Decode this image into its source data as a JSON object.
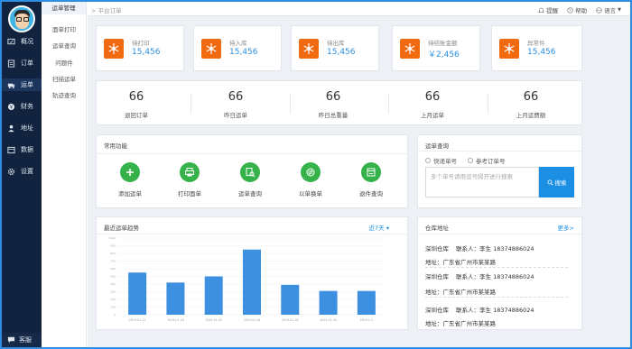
{
  "nav": {
    "items": [
      {
        "label": "概况",
        "icon": "overview-icon"
      },
      {
        "label": "订单",
        "icon": "order-icon"
      },
      {
        "label": "运单",
        "icon": "waybill-icon"
      },
      {
        "label": "财务",
        "icon": "finance-icon"
      },
      {
        "label": "地址",
        "icon": "address-icon"
      },
      {
        "label": "数据",
        "icon": "data-icon"
      },
      {
        "label": "设置",
        "icon": "settings-icon"
      }
    ],
    "support": "客服"
  },
  "submenu": {
    "header": "运单管理",
    "items": [
      "面单打印",
      "运单查询",
      "问题件",
      "扫描运单",
      "轨迹查询"
    ]
  },
  "topbar": {
    "breadcrumb": "> 平台订单",
    "remind": "提醒",
    "help": "帮助",
    "language": "语言"
  },
  "stats": [
    {
      "label": "待打印",
      "value": "15,456"
    },
    {
      "label": "待入库",
      "value": "15,456"
    },
    {
      "label": "待出库",
      "value": "15,456"
    },
    {
      "label": "待结账金额",
      "value": "￥2,456"
    },
    {
      "label": "异常件",
      "value": "15,456"
    }
  ],
  "summary": [
    {
      "value": "66",
      "label": "退回订单"
    },
    {
      "value": "66",
      "label": "昨日运单"
    },
    {
      "value": "66",
      "label": "昨日总重量"
    },
    {
      "value": "66",
      "label": "上月运单"
    },
    {
      "value": "66",
      "label": "上月运费额"
    }
  ],
  "functions": {
    "title": "常用功能",
    "items": [
      "添加运单",
      "打印面单",
      "运单查询",
      "以单换单",
      "退件查询"
    ]
  },
  "query": {
    "title": "运单查询",
    "radio1": "快递单号",
    "radio2": "参考订单号",
    "placeholder": "多个单号请用逗号隔开进行搜索",
    "button": "搜索"
  },
  "chart": {
    "title": "最近运单趋势",
    "range": "近7天"
  },
  "chart_data": {
    "type": "bar",
    "categories": [
      "2019-01-12",
      "2019-01-18",
      "2019-01-20",
      "2019-01-26",
      "2019-01-28",
      "2019-01-30",
      "2019-1-1"
    ],
    "values": [
      550,
      420,
      500,
      850,
      390,
      310,
      310
    ],
    "ylim": [
      0,
      1000
    ],
    "yticks": [
      "1000",
      "900",
      "800",
      "700",
      "600",
      "500",
      "400",
      "300",
      "200",
      "100",
      "0"
    ],
    "grid": true,
    "color": "#3d8fe0"
  },
  "warehouse": {
    "title": "仓库地址",
    "more": "更多>",
    "items": [
      {
        "name": "深圳仓库",
        "contact": "联系人：李生  18374886024",
        "address": "地址：广东省广州市某某路"
      },
      {
        "name": "深圳仓库",
        "contact": "联系人：李生  18374886024",
        "address": "地址：广东省广州市某某路"
      },
      {
        "name": "深圳仓库",
        "contact": "联系人：李生  18374886024",
        "address": "地址：广东省广州市某某路"
      }
    ]
  }
}
